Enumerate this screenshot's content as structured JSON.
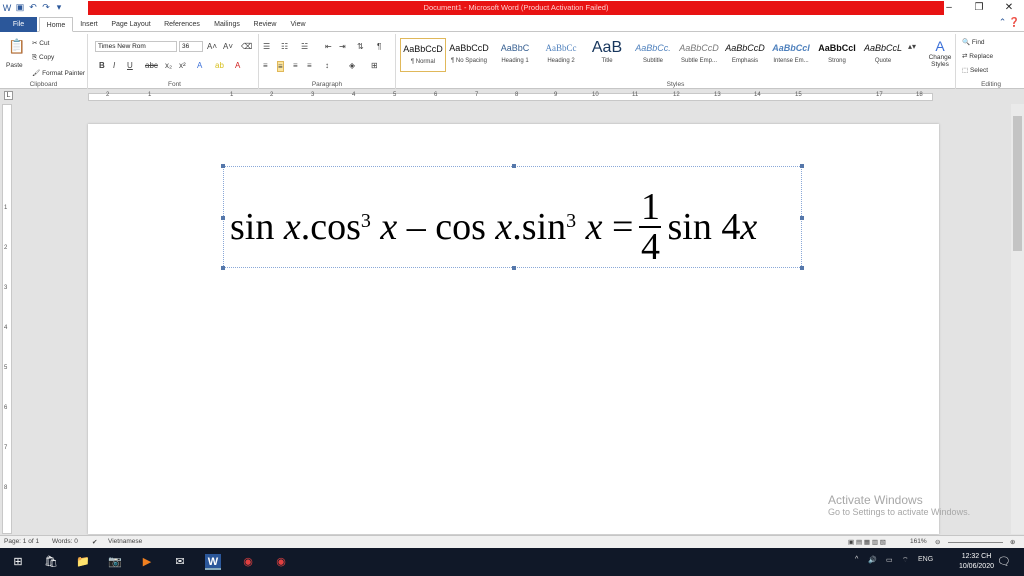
{
  "window": {
    "title": "Document1 - Microsoft Word (Product Activation Failed)",
    "controls": [
      "–",
      "❐",
      "✕"
    ]
  },
  "tabs": [
    "File",
    "Home",
    "Insert",
    "Page Layout",
    "References",
    "Mailings",
    "Review",
    "View"
  ],
  "ribbon": {
    "clipboard": {
      "paste": "Paste",
      "cut": "Cut",
      "copy": "Copy",
      "format_painter": "Format Painter",
      "label": "Clipboard"
    },
    "font": {
      "name": "Times New Rom",
      "size": "36",
      "label": "Font"
    },
    "paragraph": {
      "label": "Paragraph"
    },
    "styles": {
      "items": [
        {
          "sample": "AaBbCcD",
          "name": "¶ Normal"
        },
        {
          "sample": "AaBbCcD",
          "name": "¶ No Spacing"
        },
        {
          "sample": "AaBbC",
          "name": "Heading 1"
        },
        {
          "sample": "AaBbCc",
          "name": "Heading 2"
        },
        {
          "sample": "AaB",
          "name": "Title"
        },
        {
          "sample": "AaBbCc.",
          "name": "Subtitle"
        },
        {
          "sample": "AaBbCcD",
          "name": "Subtle Emp..."
        },
        {
          "sample": "AaBbCcD",
          "name": "Emphasis"
        },
        {
          "sample": "AaBbCcI",
          "name": "Intense Em..."
        },
        {
          "sample": "AaBbCcI",
          "name": "Strong"
        },
        {
          "sample": "AaBbCcL",
          "name": "Quote"
        }
      ],
      "change_styles": "Change Styles",
      "label": "Styles"
    },
    "editing": {
      "find": "Find",
      "replace": "Replace",
      "select": "Select",
      "label": "Editing"
    }
  },
  "ruler": [
    "2",
    "1",
    "1",
    "2",
    "3",
    "4",
    "5",
    "6",
    "7",
    "8",
    "9",
    "10",
    "11",
    "12",
    "13",
    "14",
    "15",
    "17",
    "18"
  ],
  "equation": {
    "part1": "sin",
    "var1": "x",
    "part2": ".cos",
    "exp1": "3",
    "var2": "x",
    "minus": "–",
    "part3": "cos",
    "var3": "x",
    "part4": ".sin",
    "exp2": "3",
    "var4": "x",
    "equals": "=",
    "numerator": "1",
    "denominator": "4",
    "part5": "sin 4",
    "var5": "x"
  },
  "activation": {
    "line1": "Activate Windows",
    "line2": "Go to Settings to activate Windows."
  },
  "status": {
    "page": "Page: 1 of 1",
    "words": "Words: 0",
    "language": "Vietnamese",
    "zoom": "161%"
  },
  "taskbar": {
    "lang": "ENG",
    "time": "12:32 CH",
    "date": "10/06/2020"
  }
}
